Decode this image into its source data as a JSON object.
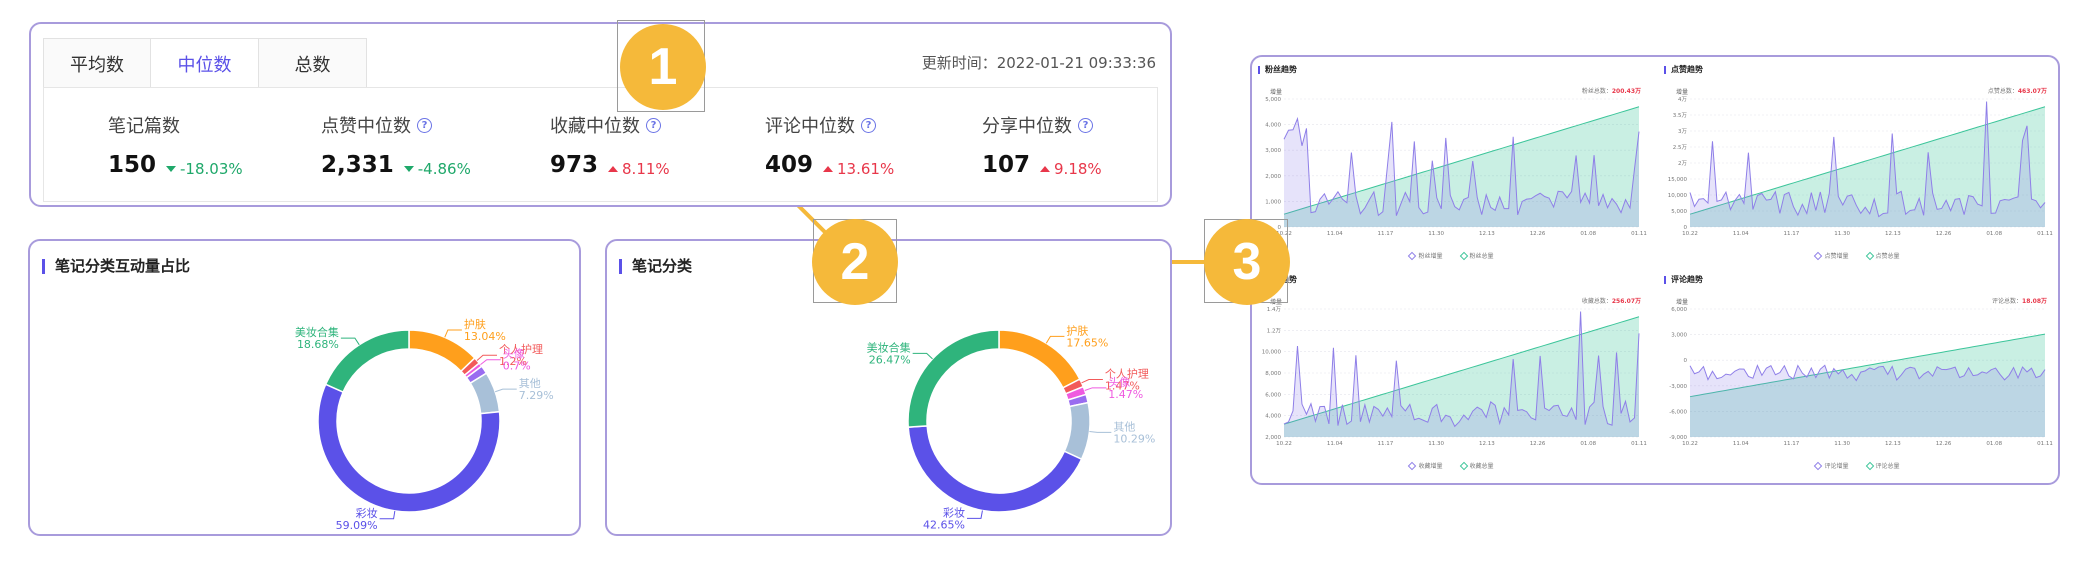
{
  "stats": {
    "tabs": [
      {
        "label": "平均数",
        "active": false
      },
      {
        "label": "中位数",
        "active": true
      },
      {
        "label": "总数",
        "active": false
      }
    ],
    "update_time": "更新时间：2022-01-21 09:33:36",
    "items": [
      {
        "label": "笔记篇数",
        "value": "150",
        "delta": "-18.03%",
        "direction": "down",
        "help": false
      },
      {
        "label": "点赞中位数",
        "value": "2,331",
        "delta": "-4.86%",
        "direction": "down",
        "help": true
      },
      {
        "label": "收藏中位数",
        "value": "973",
        "delta": "8.11%",
        "direction": "up",
        "help": true
      },
      {
        "label": "评论中位数",
        "value": "409",
        "delta": "13.61%",
        "direction": "up",
        "help": true
      },
      {
        "label": "分享中位数",
        "value": "107",
        "delta": "9.18%",
        "direction": "up",
        "help": true
      }
    ],
    "help_glyph": "?"
  },
  "donut1": {
    "title": "笔记分类互动量占比",
    "slices": [
      {
        "name": "护肤",
        "pct": "13.04%",
        "value": 13.04,
        "color": "#ff9f1c"
      },
      {
        "name": "个人护理",
        "pct": "1.2%",
        "value": 1.2,
        "color": "#f25a5a"
      },
      {
        "name": "头像",
        "pct": "0.7%",
        "value": 0.7,
        "color": "#ef5ae0"
      },
      {
        "name": "",
        "pct": "",
        "value": 1.5,
        "color": "#9a6cf0"
      },
      {
        "name": "其他",
        "pct": "7.29%",
        "value": 7.29,
        "color": "#a8c0d8"
      },
      {
        "name": "彩妆",
        "pct": "59.09%",
        "value": 59.09,
        "color": "#5b51e8"
      },
      {
        "name": "美妆合集",
        "pct": "18.68%",
        "value": 18.68,
        "color": "#2fb47c"
      }
    ]
  },
  "donut2": {
    "title": "笔记分类",
    "slices": [
      {
        "name": "护肤",
        "pct": "17.65%",
        "value": 17.65,
        "color": "#ff9f1c"
      },
      {
        "name": "个人护理",
        "pct": "1.47%",
        "value": 1.47,
        "color": "#f25a5a"
      },
      {
        "name": "头像",
        "pct": "1.47%",
        "value": 1.47,
        "color": "#ef5ae0"
      },
      {
        "name": "",
        "pct": "",
        "value": 1.5,
        "color": "#9a6cf0"
      },
      {
        "name": "其他",
        "pct": "10.29%",
        "value": 10.29,
        "color": "#a8c0d8"
      },
      {
        "name": "彩妆",
        "pct": "42.65%",
        "value": 42.65,
        "color": "#5b51e8"
      },
      {
        "name": "美妆合集",
        "pct": "26.47%",
        "value": 26.47,
        "color": "#2fb47c"
      }
    ]
  },
  "trends": {
    "x_ticks": [
      "10.22",
      "11.04",
      "11.17",
      "11.30",
      "12.13",
      "12.26",
      "01.08",
      "01.11"
    ],
    "axis_title": "增量",
    "charts": [
      {
        "title": "粉丝趋势",
        "total_label": "粉丝总数：",
        "total_value": "200.43万",
        "y_ticks": [
          "5,000",
          "4,000",
          "3,000",
          "2,000",
          "1,000",
          "0"
        ],
        "legend": [
          "粉丝增量",
          "粉丝总量"
        ]
      },
      {
        "title": "点赞趋势",
        "total_label": "点赞总数：",
        "total_value": "463.07万",
        "y_ticks": [
          "4万",
          "3.5万",
          "3万",
          "2.5万",
          "2万",
          "15,000",
          "10,000",
          "5,000",
          "0"
        ],
        "legend": [
          "点赞增量",
          "点赞总量"
        ]
      },
      {
        "title": "收藏趋势",
        "total_label": "收藏总数：",
        "total_value": "256.07万",
        "y_ticks": [
          "1.4万",
          "1.2万",
          "10,000",
          "8,000",
          "6,000",
          "4,000",
          "2,000"
        ],
        "legend": [
          "收藏增量",
          "收藏总量"
        ]
      },
      {
        "title": "评论趋势",
        "total_label": "评论总数：",
        "total_value": "18.08万",
        "y_ticks": [
          "6,000",
          "3,000",
          "0",
          "-3,000",
          "-6,000",
          "-9,000"
        ],
        "legend": [
          "评论增量",
          "评论总量"
        ]
      }
    ],
    "colors": {
      "increment": "#8f7fe8",
      "total": "#3cc59a"
    }
  },
  "callouts": [
    "1",
    "2",
    "3"
  ],
  "colors": {
    "accent": "#5b51e8",
    "panel_border": "#a89bdc",
    "callout": "#f5b93a",
    "up": "#e8374a",
    "down": "#1fa86a"
  }
}
